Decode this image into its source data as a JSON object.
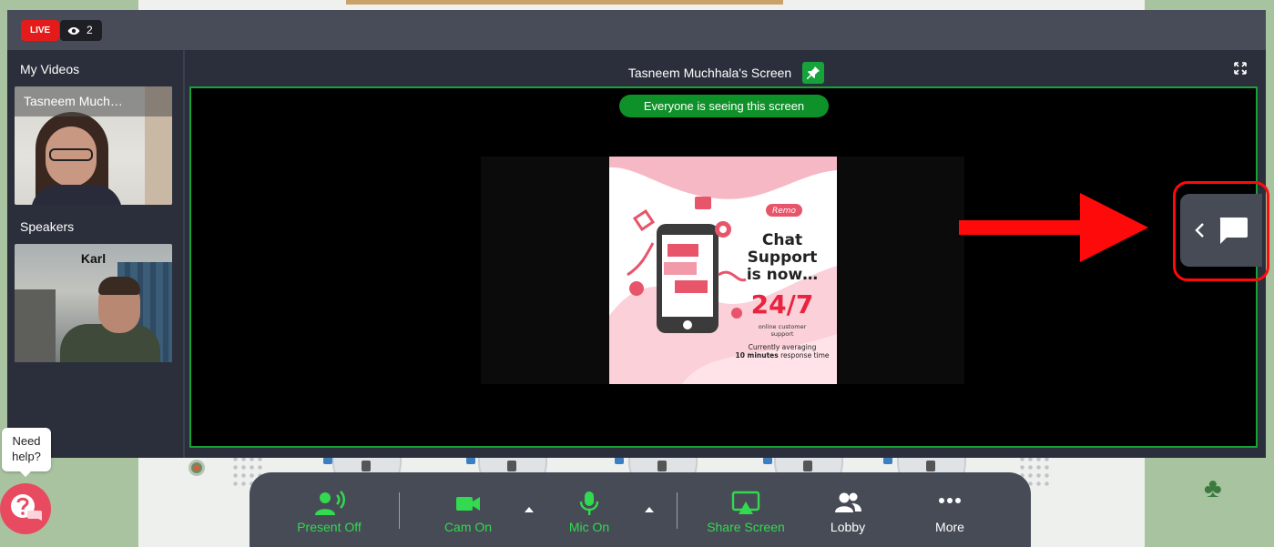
{
  "stream": {
    "live_label": "LIVE",
    "viewer_count": "2"
  },
  "sidebar": {
    "my_videos_label": "My Videos",
    "my_video_name": "Tasneem Much…",
    "speakers_label": "Speakers",
    "speaker_name": "Karl"
  },
  "screen": {
    "title": "Tasneem Muchhala's Screen",
    "status_pill": "Everyone is seeing this screen"
  },
  "slide": {
    "brand": "Remo",
    "headline_1": "Chat",
    "headline_2": "Support",
    "headline_3": "is now…",
    "big_number": "24/7",
    "sub_1": "online customer",
    "sub_2": "support",
    "foot_1": "Currently averaging",
    "foot_2_bold": "10 minutes",
    "foot_2_rest": " response time"
  },
  "toolbar": {
    "present": "Present Off",
    "cam": "Cam On",
    "mic": "Mic On",
    "share": "Share Screen",
    "lobby": "Lobby",
    "more": "More"
  },
  "help": {
    "line1": "Need",
    "line2": "help?"
  },
  "colors": {
    "live_red": "#e31b1b",
    "active_green": "#33d94f",
    "frame_green": "#16a234",
    "annotation_red": "#ff0a0a"
  }
}
